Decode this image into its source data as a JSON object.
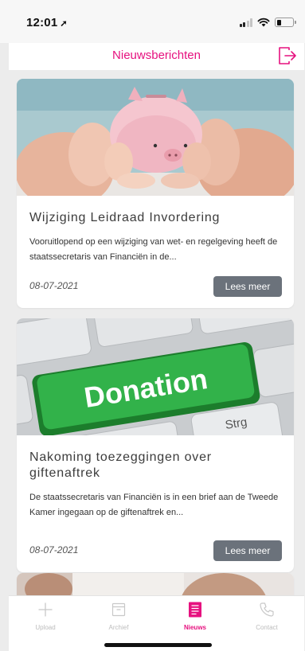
{
  "status_bar": {
    "time": "12:01",
    "location_glyph": "➚"
  },
  "header": {
    "title": "Nieuwsberichten",
    "logout_icon": "logout-icon"
  },
  "articles": [
    {
      "image_alt": "piggy-bank-in-hands",
      "title": "Wijziging Leidraad Invordering",
      "excerpt": "Vooruitlopend op een wijziging van wet- en regelgeving heeft de staatssecretaris van Financiën in de...",
      "date": "08-07-2021",
      "button": "Lees meer"
    },
    {
      "image_alt": "donation-keyboard-key",
      "image_text": "Donation",
      "key_label": "Strg",
      "title": "Nakoming toezeggingen over giftenaftrek",
      "excerpt": "De staatssecretaris van Financiën is in een brief aan de Tweede Kamer ingegaan op de giftenaftrek en...",
      "date": "08-07-2021",
      "button": "Lees meer"
    }
  ],
  "tabs": [
    {
      "label": "Upload",
      "icon": "plus-icon",
      "active": false
    },
    {
      "label": "Archief",
      "icon": "archive-icon",
      "active": false
    },
    {
      "label": "Nieuws",
      "icon": "news-icon",
      "active": true
    },
    {
      "label": "Contact",
      "icon": "phone-icon",
      "active": false
    }
  ],
  "colors": {
    "accent": "#e6117f",
    "button": "#6b727b",
    "background": "#ececec"
  }
}
